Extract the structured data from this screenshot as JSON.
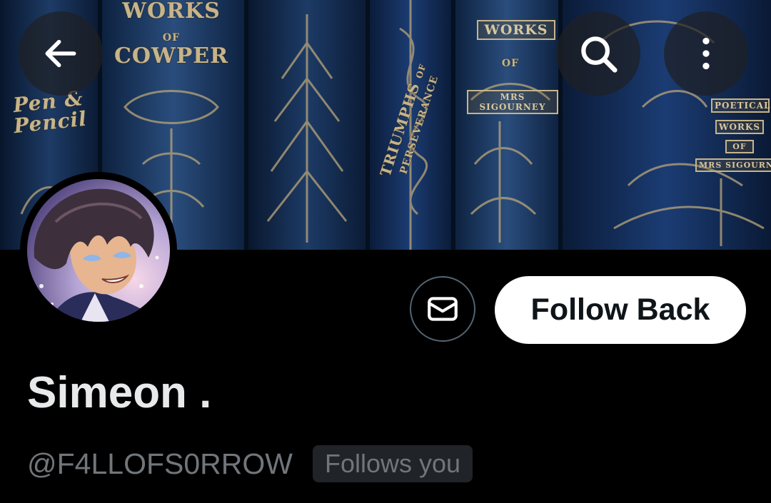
{
  "banner": {
    "books": [
      {
        "title_lines": [
          "WORKS",
          "OF",
          "COWPER"
        ]
      },
      {
        "title_lines": [
          "Pen &",
          "Pencil"
        ]
      },
      {
        "title_lines": [
          "TRIUMPHS",
          "OF",
          "PERSEVERANCE"
        ]
      },
      {
        "title_lines": [
          "WORKS",
          "OF",
          "MRS SIGOURNEY"
        ]
      },
      {
        "title_lines": [
          "POETICAL",
          "WORKS",
          "OF",
          "MRS SIGOURNEY"
        ]
      }
    ]
  },
  "header": {
    "back_icon": "arrow-left-icon",
    "search_icon": "search-icon",
    "more_icon": "more-vertical-icon"
  },
  "profile": {
    "display_name": "Simeon .",
    "handle": "@F4LLOFS0RROW",
    "follows_you_badge": "Follows you"
  },
  "actions": {
    "message_icon": "envelope-icon",
    "follow_label": "Follow Back"
  },
  "colors": {
    "background": "#000000",
    "primary_text": "#e7e9ea",
    "secondary_text": "#71767b",
    "button_bg": "#ffffff",
    "button_text": "#0f1419",
    "outline": "#536471",
    "badge_bg": "#202327"
  }
}
